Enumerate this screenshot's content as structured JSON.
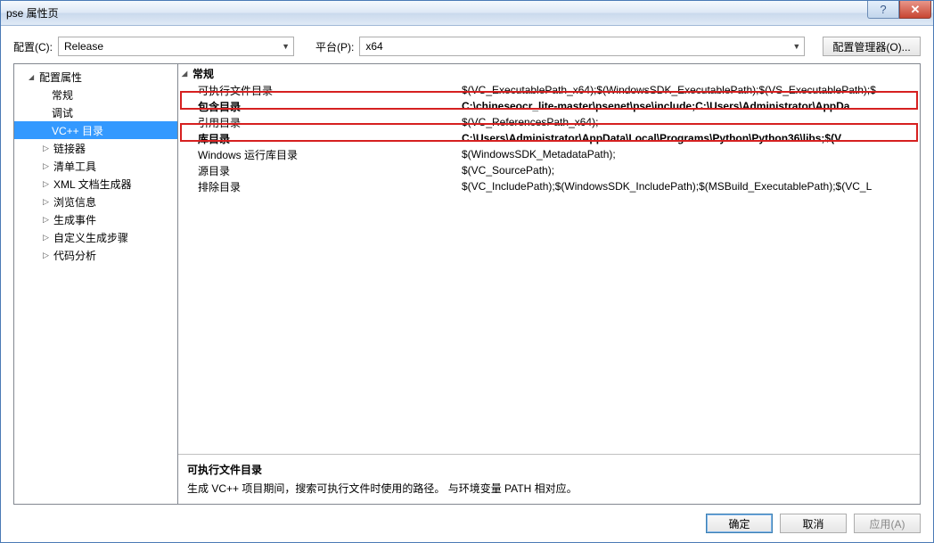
{
  "title": "pse 属性页",
  "toolbar": {
    "config_label": "配置(C):",
    "config_value": "Release",
    "platform_label": "平台(P):",
    "platform_value": "x64",
    "config_manager": "配置管理器(O)..."
  },
  "tree": {
    "root": "配置属性",
    "items": [
      {
        "label": "常规",
        "expandable": false
      },
      {
        "label": "调试",
        "expandable": false
      },
      {
        "label": "VC++ 目录",
        "expandable": false,
        "selected": true
      },
      {
        "label": "链接器",
        "expandable": true
      },
      {
        "label": "清单工具",
        "expandable": true
      },
      {
        "label": "XML 文档生成器",
        "expandable": true
      },
      {
        "label": "浏览信息",
        "expandable": true
      },
      {
        "label": "生成事件",
        "expandable": true
      },
      {
        "label": "自定义生成步骤",
        "expandable": true
      },
      {
        "label": "代码分析",
        "expandable": true
      }
    ]
  },
  "props": {
    "group": "常规",
    "rows": [
      {
        "label": "可执行文件目录",
        "value": "$(VC_ExecutablePath_x64);$(WindowsSDK_ExecutablePath);$(VS_ExecutablePath);$"
      },
      {
        "label": "包含目录",
        "value": "C:\\chineseocr_lite-master\\psenet\\pse\\include;C:\\Users\\Administrator\\AppDa",
        "bold": true
      },
      {
        "label": "引用目录",
        "value": "$(VC_ReferencesPath_x64);"
      },
      {
        "label": "库目录",
        "value": "C:\\Users\\Administrator\\AppData\\Local\\Programs\\Python\\Python36\\libs;$(V",
        "bold": true
      },
      {
        "label": "Windows 运行库目录",
        "value": "$(WindowsSDK_MetadataPath);"
      },
      {
        "label": "源目录",
        "value": "$(VC_SourcePath);"
      },
      {
        "label": "排除目录",
        "value": "$(VC_IncludePath);$(WindowsSDK_IncludePath);$(MSBuild_ExecutablePath);$(VC_L"
      }
    ]
  },
  "desc": {
    "title": "可执行文件目录",
    "text": "生成 VC++ 项目期间，搜索可执行文件时使用的路径。  与环境变量 PATH 相对应。"
  },
  "footer": {
    "ok": "确定",
    "cancel": "取消",
    "apply": "应用(A)"
  }
}
